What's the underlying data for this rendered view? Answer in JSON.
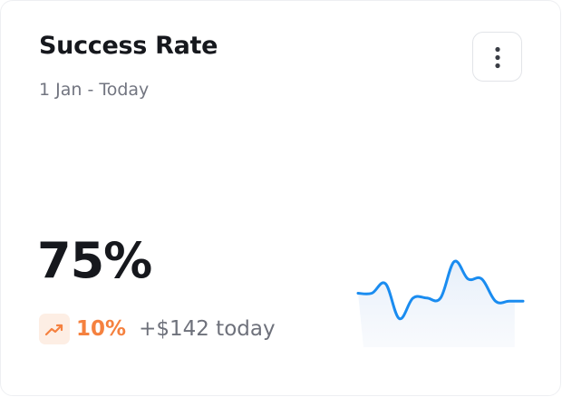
{
  "card": {
    "title": "Success Rate",
    "subtitle": "1 Jan - Today",
    "menu_icon": "vertical-ellipsis-icon"
  },
  "metric": {
    "value": "75%",
    "trend_icon": "trending-up-icon",
    "trend_percent": "10%",
    "trend_note": "+$142 today"
  },
  "colors": {
    "accent_line": "#1a8cf0",
    "trend_orange": "#f5813f",
    "trend_bg": "#fdeee4"
  },
  "chart_data": {
    "type": "line",
    "title": "",
    "xlabel": "",
    "ylabel": "",
    "x": [
      0,
      1,
      2,
      3,
      4,
      5,
      6,
      7,
      8,
      9,
      10,
      11,
      12
    ],
    "series": [
      {
        "values": [
          30,
          30,
          36,
          14,
          27,
          27,
          27,
          50,
          39,
          39,
          25,
          25,
          25
        ]
      }
    ],
    "ylim": [
      0,
      60
    ],
    "grid": false,
    "legend": "none"
  }
}
